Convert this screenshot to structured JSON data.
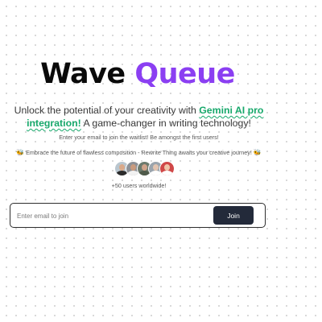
{
  "hero": {
    "title_part1": "Wave",
    "title_part2": "Queue",
    "accent_color": "#8b3ff2"
  },
  "tagline": {
    "before": "Unlock the potential of your creativity with ",
    "highlight": "Gemini AI pro integration!",
    "after": " A game-changer in writing technology!",
    "highlight_color": "#17a86b"
  },
  "subtext": "Enter your email to join the waitlist! Be amongst the first users!",
  "embrace": {
    "icon": "bee-icon",
    "emoji": "🐝",
    "text": " Embrace the future of flawless composition - Rewrite Thing awaits your creative journey! "
  },
  "avatars": [
    {
      "name": "avatar-1",
      "bg": "#b9c6cf",
      "skin": "#d9a98a",
      "shirt": "#2b2b2b"
    },
    {
      "name": "avatar-2",
      "bg": "#8d9197",
      "skin": "#c89a7e",
      "shirt": "#f2f2f2"
    },
    {
      "name": "avatar-3",
      "bg": "#6c7a6d",
      "skin": "#cfa38a",
      "shirt": "#4f5a4a"
    },
    {
      "name": "avatar-4",
      "bg": "#9aa4ad",
      "skin": "#e2c4b0",
      "shirt": "#ffffff"
    },
    {
      "name": "avatar-5",
      "bg": "#d04848",
      "skin": "#efc4a8",
      "shirt": "#ffffff"
    }
  ],
  "users_count": "+50 users worldwide!",
  "waitlist": {
    "placeholder": "Enter email to join",
    "button_label": "Join",
    "button_color": "#232a3a"
  }
}
